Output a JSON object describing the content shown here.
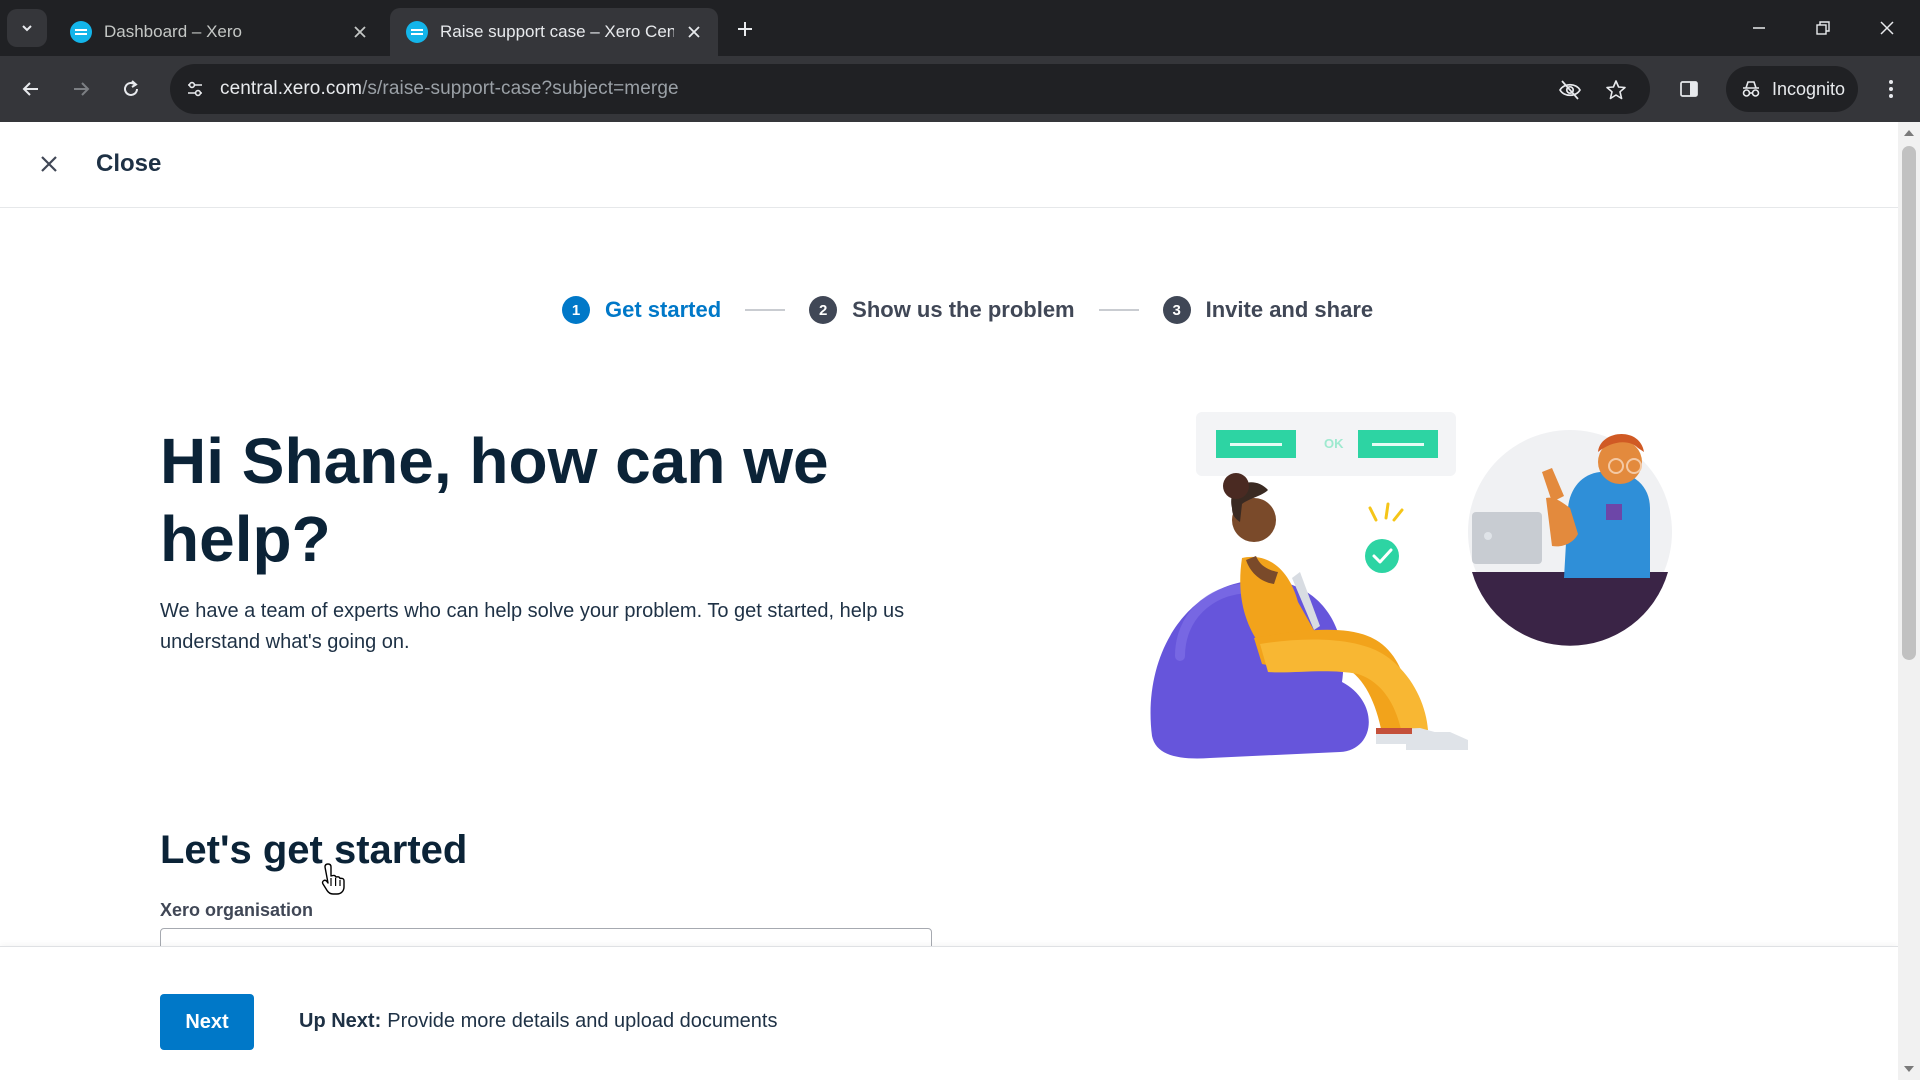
{
  "browser": {
    "tabs": [
      {
        "title": "Dashboard – Xero",
        "active": false
      },
      {
        "title": "Raise support case – Xero Central",
        "active": true
      }
    ],
    "url_host": "central.xero.com",
    "url_path": "/s/raise-support-case?subject=merge",
    "incognito_label": "Incognito",
    "icons": {
      "tab_list": "chevron-down-icon",
      "new_tab": "plus-icon",
      "back": "arrow-left-icon",
      "forward": "arrow-right-icon",
      "reload": "reload-icon",
      "site_info": "tune-icon",
      "tracking": "eye-off-icon",
      "bookmark": "star-icon",
      "side_panel": "side-panel-icon",
      "menu": "kebab-menu-icon"
    }
  },
  "page": {
    "close_label": "Close",
    "steps": [
      {
        "number": "1",
        "label": "Get started",
        "current": true
      },
      {
        "number": "2",
        "label": "Show us the problem",
        "current": false
      },
      {
        "number": "3",
        "label": "Invite and share",
        "current": false
      }
    ],
    "hero_title": "Hi Shane, how can we help?",
    "hero_text": "We have a team of experts who can help solve your problem. To get started, help us understand what's going on.",
    "illustration_ok": "OK",
    "section_title": "Let's get started",
    "org_field_label": "Xero organisation",
    "org_field_value": "",
    "footer": {
      "next_label": "Next",
      "up_next_label": "Up Next:",
      "up_next_text": "Provide more details and upload documents"
    }
  },
  "colors": {
    "primary_blue": "#0078c8",
    "heading_navy": "#0b2337",
    "xero_favicon": "#13b5ea",
    "chrome_dark": "#202124",
    "chrome_toolbar": "#35363a"
  }
}
